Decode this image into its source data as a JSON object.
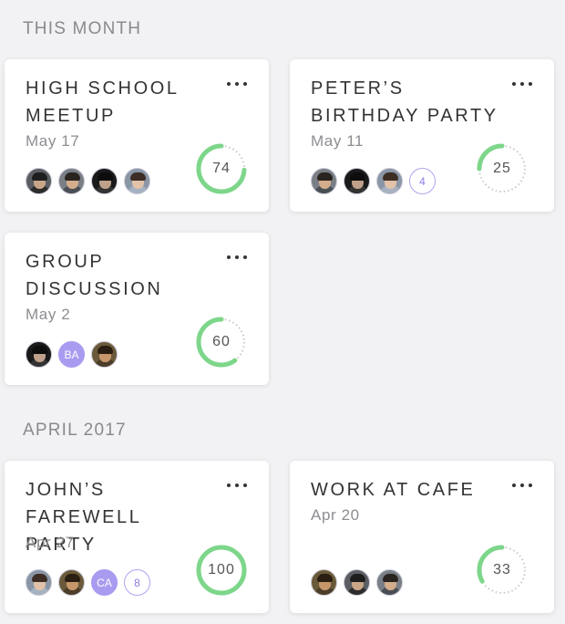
{
  "colors": {
    "progress_fill": "#7dd68a",
    "progress_track": "#c9c9c9",
    "avatar_accent": "#a99bf0",
    "count_text": "#8f7de8"
  },
  "sections": [
    {
      "title": "THIS MONTH"
    },
    {
      "title": "APRIL 2017"
    }
  ],
  "cards": [
    {
      "title": "HIGH SCHOOL\nMEETUP",
      "date": "May 17",
      "progress": 74,
      "progress_label": "74",
      "more_icon": "more-horizontal-icon",
      "avatars": [
        {
          "type": "photo",
          "icon": "user-avatar-icon"
        },
        {
          "type": "photo",
          "icon": "user-avatar-icon"
        },
        {
          "type": "photo",
          "icon": "user-avatar-icon"
        },
        {
          "type": "photo",
          "icon": "user-avatar-icon"
        }
      ]
    },
    {
      "title": "PETER’S\nBIRTHDAY PARTY",
      "date": "May 11",
      "progress": 25,
      "progress_label": "25",
      "more_icon": "more-horizontal-icon",
      "avatars": [
        {
          "type": "photo",
          "icon": "user-avatar-icon"
        },
        {
          "type": "photo",
          "icon": "user-avatar-icon"
        },
        {
          "type": "photo",
          "icon": "user-avatar-icon"
        },
        {
          "type": "count",
          "text": "4"
        }
      ]
    },
    {
      "title": "GROUP\nDISCUSSION",
      "date": "May 2",
      "progress": 60,
      "progress_label": "60",
      "more_icon": "more-horizontal-icon",
      "avatars": [
        {
          "type": "photo",
          "icon": "user-avatar-icon"
        },
        {
          "type": "initials",
          "text": "BA"
        },
        {
          "type": "photo",
          "icon": "user-avatar-icon"
        }
      ]
    },
    {
      "title": "JOHN’S\nFAREWELL PARTY",
      "date": "Apr 27",
      "progress": 100,
      "progress_label": "100",
      "more_icon": "more-horizontal-icon",
      "avatars": [
        {
          "type": "photo",
          "icon": "user-avatar-icon"
        },
        {
          "type": "photo",
          "icon": "user-avatar-icon"
        },
        {
          "type": "initials",
          "text": "CA"
        },
        {
          "type": "count",
          "text": "8"
        }
      ]
    },
    {
      "title": "WORK AT CAFE",
      "date": "Apr 20",
      "progress": 33,
      "progress_label": "33",
      "more_icon": "more-horizontal-icon",
      "avatars": [
        {
          "type": "photo",
          "icon": "user-avatar-icon"
        },
        {
          "type": "photo",
          "icon": "user-avatar-icon"
        },
        {
          "type": "photo",
          "icon": "user-avatar-icon"
        }
      ]
    }
  ]
}
